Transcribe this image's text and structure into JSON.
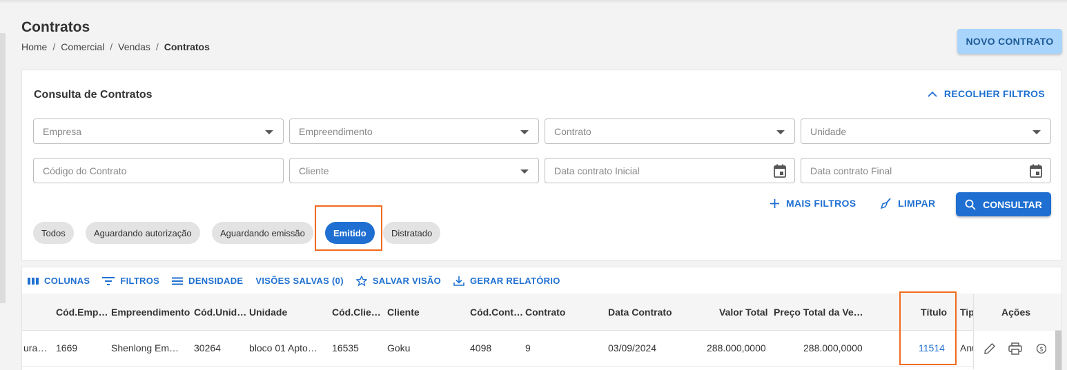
{
  "page": {
    "title": "Contratos",
    "breadcrumb": [
      "Home",
      "Comercial",
      "Vendas",
      "Contratos"
    ],
    "new_button": "NOVO CONTRATO"
  },
  "filters": {
    "title": "Consulta de Contratos",
    "collapse_label": "RECOLHER FILTROS",
    "fields": {
      "empresa": "Empresa",
      "empreendimento": "Empreendimento",
      "contrato": "Contrato",
      "unidade": "Unidade",
      "codigo_contrato": "Código do Contrato",
      "cliente": "Cliente",
      "data_inicial": "Data contrato Inicial",
      "data_final": "Data contrato Final"
    },
    "more_filters": "MAIS FILTROS",
    "clear": "LIMPAR",
    "search": "CONSULTAR",
    "status_chips": [
      "Todos",
      "Aguardando autorização",
      "Aguardando emissão",
      "Emitido",
      "Distratado"
    ],
    "active_chip": "Emitido"
  },
  "grid": {
    "toolbar": {
      "columns": "COLUNAS",
      "filters": "FILTROS",
      "density": "DENSIDADE",
      "saved_views": "VISÕES SALVAS (0)",
      "save_view": "SALVAR VISÃO",
      "report": "GERAR RELATÓRIO"
    },
    "headers": [
      "Cód.Emp…",
      "Empreendimento",
      "Cód.Unid…",
      "Unidade",
      "Cód.Clie…",
      "Cliente",
      "Cód.Cont…",
      "Contrato",
      "Data Contrato",
      "Valor Total",
      "Preço Total da Ve…",
      "Título",
      "Tip",
      "Ações"
    ],
    "rows": [
      {
        "col0": "ura…",
        "cod_emp": "1669",
        "empreendimento": "Shenlong Em…",
        "cod_unid": "30264",
        "unidade": "bloco 01 Apto…",
        "cod_cli": "16535",
        "cliente": "Goku",
        "cod_cont": "4098",
        "contrato": "9",
        "data": "03/09/2024",
        "valor_total": "288.000,0000",
        "preco_total": "288.000,0000",
        "titulo": "11514",
        "tipo": "Anu"
      }
    ]
  },
  "colors": {
    "accent": "#1e6fd1",
    "highlight": "#f06a1d",
    "new_button_bg": "#a9d4fb"
  }
}
